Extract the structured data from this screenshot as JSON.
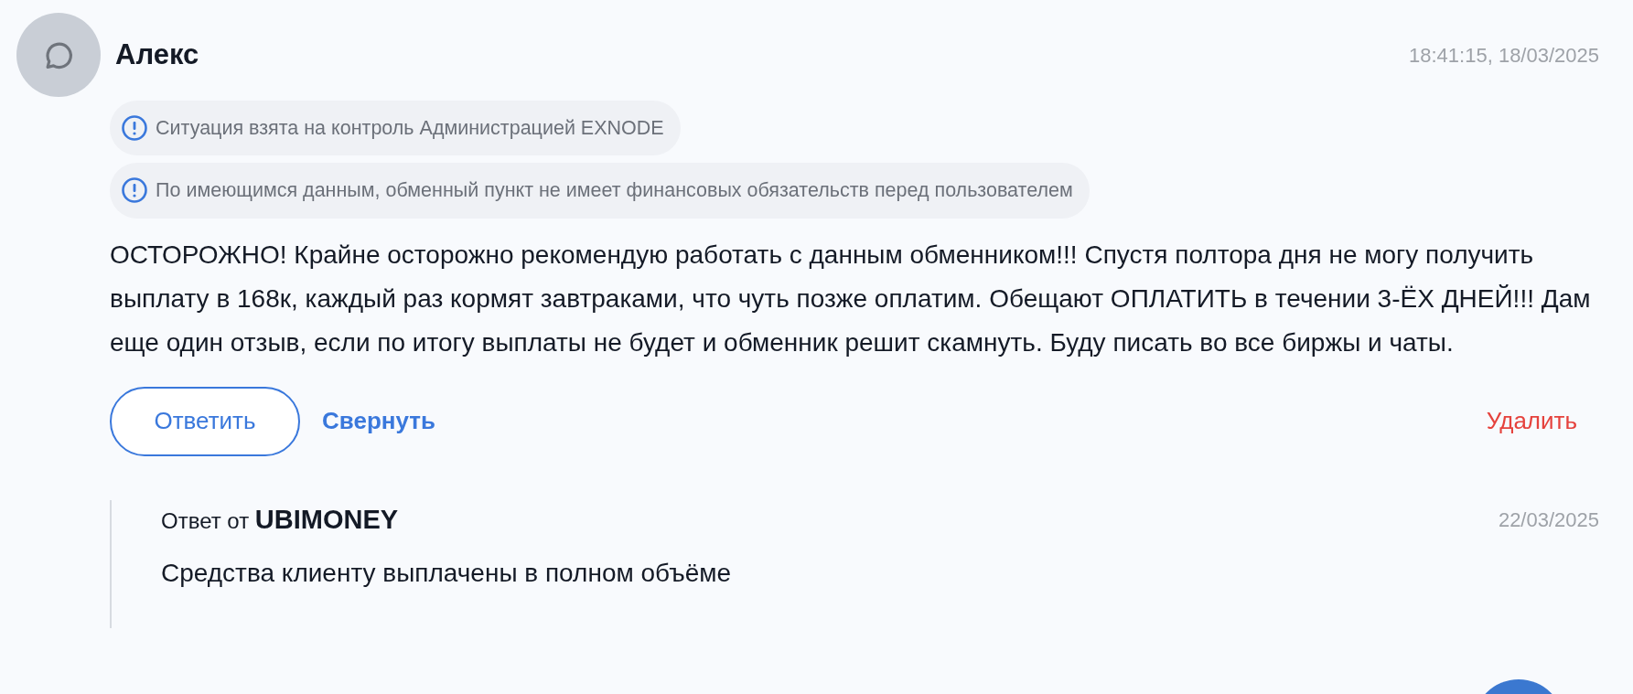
{
  "comment": {
    "author": "Алекс",
    "timestamp": "18:41:15, 18/03/2025",
    "notices": [
      "Ситуация взята на контроль Администрацией EXNODE",
      "По имеющимся данным, обменный пункт не имеет финансовых обязательств перед пользователем"
    ],
    "text": "ОСТОРОЖНО! Крайне осторожно рекомендую работать с данным обменником!!! Спустя полтора дня не могу получить выплату в 168к, каждый раз кормят завтраками, что чуть позже оплатим. Обещают ОПЛАТИТЬ в течении 3-ЁХ ДНЕЙ!!! Дам еще один отзыв, если по итогу выплаты не будет и обменник решит скамнуть. Буду писать во все биржы и чаты.",
    "actions": {
      "reply": "Ответить",
      "collapse": "Свернуть",
      "delete": "Удалить"
    },
    "replies": [
      {
        "heading": "Ответ от **UBIMONEY**",
        "date": "22/03/2025",
        "text": "Средства клиенту выплачены в полном объёме"
      }
    ]
  }
}
